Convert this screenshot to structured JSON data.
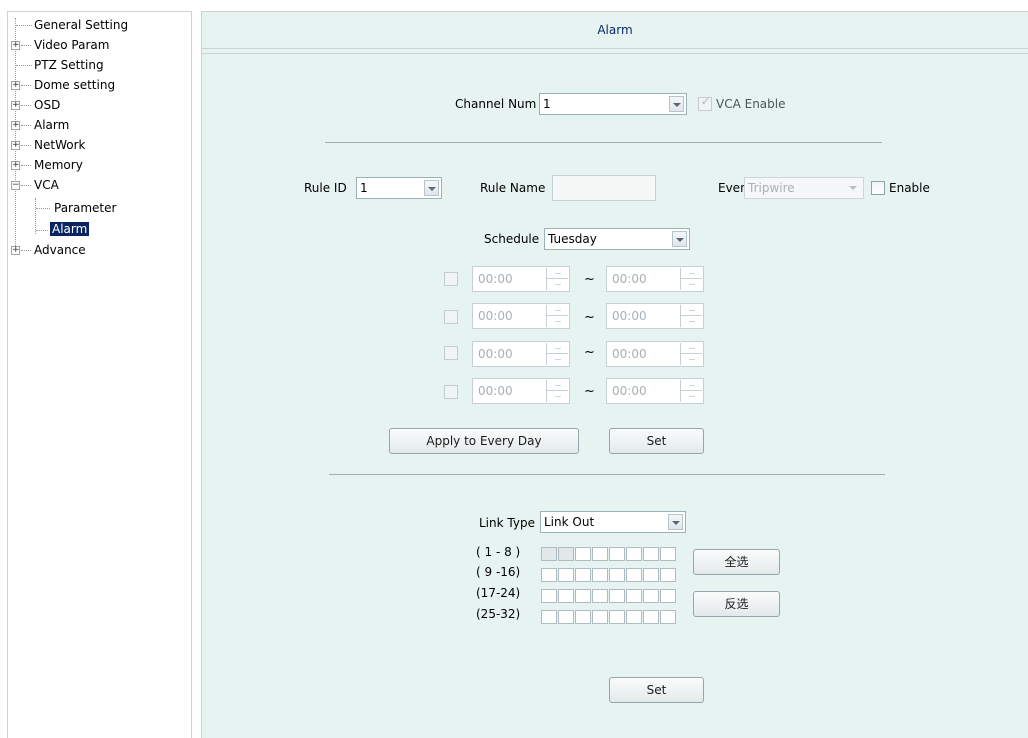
{
  "tree": {
    "items": [
      {
        "label": "General Setting"
      },
      {
        "label": "Video Param"
      },
      {
        "label": "PTZ Setting"
      },
      {
        "label": "Dome setting"
      },
      {
        "label": "OSD"
      },
      {
        "label": "Alarm"
      },
      {
        "label": "NetWork"
      },
      {
        "label": "Memory"
      },
      {
        "label": "VCA"
      },
      {
        "label": "Parameter"
      },
      {
        "label": "Alarm"
      },
      {
        "label": "Advance"
      }
    ],
    "expand_plus": "+",
    "expand_minus": "−"
  },
  "panel": {
    "title": "Alarm",
    "channel_num_label": "Channel Num",
    "channel_num_value": "1",
    "vca_enable_label": "VCA Enable",
    "rule_id_label": "Rule ID",
    "rule_id_value": "1",
    "rule_name_label": "Rule Name",
    "rule_name_value": "",
    "event_label": "Event",
    "event_value": "Tripwire",
    "enable_label": "Enable",
    "schedule_label": "Schedule",
    "schedule_value": "Tuesday",
    "time_rows": [
      {
        "start": "00:00",
        "end": "00:00"
      },
      {
        "start": "00:00",
        "end": "00:00"
      },
      {
        "start": "00:00",
        "end": "00:00"
      },
      {
        "start": "00:00",
        "end": "00:00"
      }
    ],
    "tilde": "~",
    "apply_every_day_label": "Apply to Every Day",
    "set_label": "Set",
    "link_type_label": "Link Type",
    "link_type_value": "Link Out",
    "ranges": [
      "( 1 - 8 )",
      "( 9 -16)",
      "(17-24)",
      "(25-32)"
    ],
    "select_all_label": "全选",
    "invert_label": "反选",
    "bottom_set_label": "Set"
  }
}
